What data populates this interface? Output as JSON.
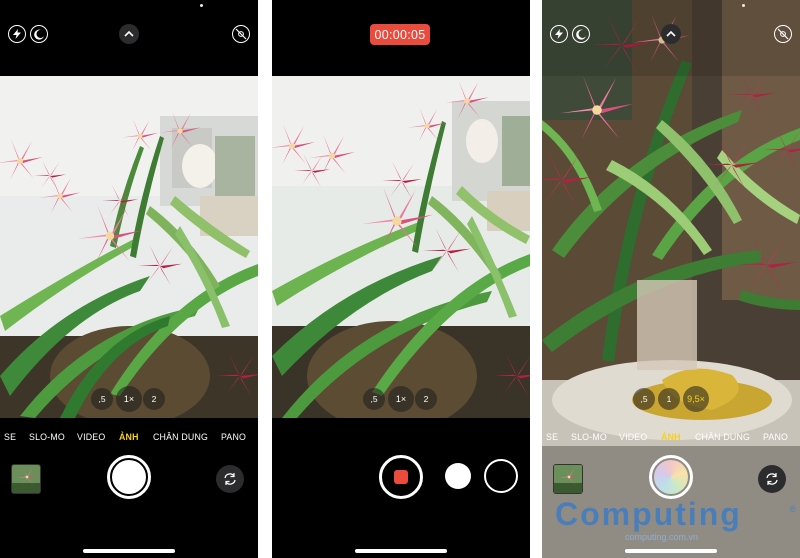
{
  "screens": [
    {
      "zoom_levels": [
        ",5",
        "1×",
        "2"
      ],
      "modes": [
        "SE",
        "SLO-MO",
        "VIDEO",
        "ẢNH",
        "CHÂN DUNG",
        "PANO"
      ],
      "active_mode": "ẢNH"
    },
    {
      "recording_timer": "00:00:05",
      "zoom_levels": [
        ",5",
        "1×",
        "2"
      ]
    },
    {
      "zoom_levels": [
        ",5",
        "1",
        "9,5×"
      ],
      "modes": [
        "SE",
        "SLO-MO",
        "VIDEO",
        "ẢNH",
        "CHÂN DUNG",
        "PANO"
      ],
      "active_mode": "ẢNH"
    }
  ],
  "watermark": {
    "brand": "Computing",
    "sub": "computing.com.vn",
    "reg": "®"
  },
  "colors": {
    "accent_mode": "#f7d01c",
    "record_red": "#e94b3c",
    "watermark_blue": "#3e7cc4"
  },
  "icons": [
    "flash-off-icon",
    "live-photo-icon",
    "chevron-up-icon",
    "live-off-icon",
    "camera-flip-icon"
  ]
}
